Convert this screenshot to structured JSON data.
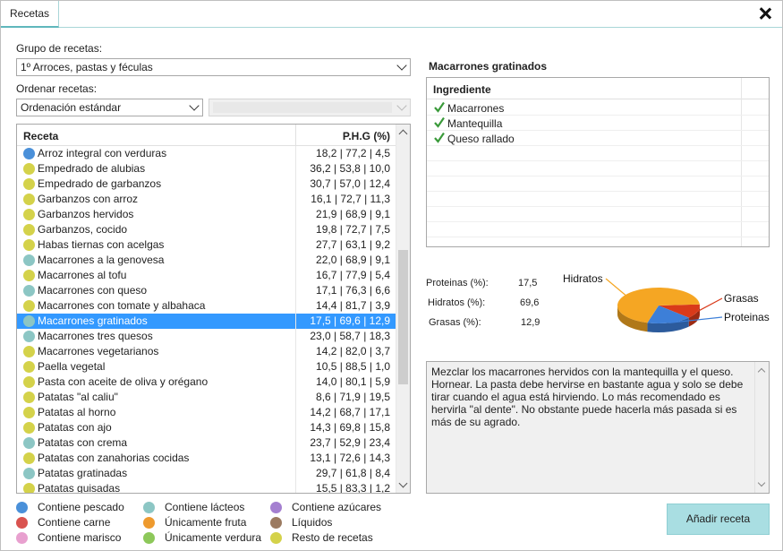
{
  "window": {
    "tab_label": "Recetas"
  },
  "filters": {
    "group_label": "Grupo de recetas:",
    "group_value": "1º Arroces, pastas y féculas",
    "order_label": "Ordenar recetas:",
    "order_value": "Ordenación estándar",
    "secondary_value": ""
  },
  "recipes": {
    "col_name": "Receta",
    "col_phg": "P.H.G (%)",
    "rows": [
      {
        "name": "Arroz integral con verduras",
        "phg": "18,2 | 77,2 | 4,5",
        "color": "#4a90d9"
      },
      {
        "name": "Empedrado de alubias",
        "phg": "36,2 | 53,8 | 10,0",
        "color": "#d4d24a"
      },
      {
        "name": "Empedrado de garbanzos",
        "phg": "30,7 | 57,0 | 12,4",
        "color": "#d4d24a"
      },
      {
        "name": "Garbanzos con arroz",
        "phg": "16,1 | 72,7 | 11,3",
        "color": "#d4d24a"
      },
      {
        "name": "Garbanzos hervidos",
        "phg": "21,9 | 68,9 | 9,1",
        "color": "#d4d24a"
      },
      {
        "name": "Garbanzos, cocido",
        "phg": "19,8 | 72,7 | 7,5",
        "color": "#d4d24a"
      },
      {
        "name": "Habas tiernas con acelgas",
        "phg": "27,7 | 63,1 | 9,2",
        "color": "#d4d24a"
      },
      {
        "name": "Macarrones a la genovesa",
        "phg": "22,0 | 68,9 | 9,1",
        "color": "#8cc6c4"
      },
      {
        "name": "Macarrones al tofu",
        "phg": "16,7 | 77,9 | 5,4",
        "color": "#d4d24a"
      },
      {
        "name": "Macarrones con queso",
        "phg": "17,1 | 76,3 | 6,6",
        "color": "#8cc6c4"
      },
      {
        "name": "Macarrones con tomate y albahaca",
        "phg": "14,4 | 81,7 | 3,9",
        "color": "#d4d24a"
      },
      {
        "name": "Macarrones gratinados",
        "phg": "17,5 | 69,6 | 12,9",
        "color": "#8cc6c4",
        "selected": true
      },
      {
        "name": "Macarrones tres quesos",
        "phg": "23,0 | 58,7 | 18,3",
        "color": "#8cc6c4"
      },
      {
        "name": "Macarrones vegetarianos",
        "phg": "14,2 | 82,0 | 3,7",
        "color": "#d4d24a"
      },
      {
        "name": "Paella vegetal",
        "phg": "10,5 | 88,5 | 1,0",
        "color": "#d4d24a"
      },
      {
        "name": "Pasta con aceite de oliva y orégano",
        "phg": "14,0 | 80,1 | 5,9",
        "color": "#d4d24a"
      },
      {
        "name": "Patatas \"al caliu\"",
        "phg": "8,6 | 71,9 | 19,5",
        "color": "#d4d24a"
      },
      {
        "name": "Patatas al horno",
        "phg": "14,2 | 68,7 | 17,1",
        "color": "#d4d24a"
      },
      {
        "name": "Patatas con ajo",
        "phg": "14,3 | 69,8 | 15,8",
        "color": "#d4d24a"
      },
      {
        "name": "Patatas con crema",
        "phg": "23,7 | 52,9 | 23,4",
        "color": "#8cc6c4"
      },
      {
        "name": "Patatas con zanahorias cocidas",
        "phg": "13,1 | 72,6 | 14,3",
        "color": "#d4d24a"
      },
      {
        "name": "Patatas gratinadas",
        "phg": "29,7 | 61,8 | 8,4",
        "color": "#8cc6c4"
      },
      {
        "name": "Patatas guisadas",
        "phg": "15,5 | 83,3 | 1,2",
        "color": "#d4d24a"
      }
    ]
  },
  "legend": [
    {
      "label": "Contiene pescado",
      "color": "#4a90d9"
    },
    {
      "label": "Contiene carne",
      "color": "#d9534f"
    },
    {
      "label": "Contiene marisco",
      "color": "#e8a0cf"
    },
    {
      "label": "Contiene lácteos",
      "color": "#8cc6c4"
    },
    {
      "label": "Únicamente fruta",
      "color": "#ee9a2e"
    },
    {
      "label": "Únicamente verdura",
      "color": "#8dc85a"
    },
    {
      "label": "Contiene azúcares",
      "color": "#a47fd0"
    },
    {
      "label": "Líquidos",
      "color": "#9b7a60"
    },
    {
      "label": "Resto de recetas",
      "color": "#d4d24a"
    }
  ],
  "detail": {
    "title": "Macarrones gratinados",
    "ing_header": "Ingrediente",
    "ingredients": [
      "Macarrones",
      "Mantequilla",
      "Queso rallado"
    ],
    "stats": [
      {
        "label": "Proteinas (%):",
        "value": "17,5"
      },
      {
        "label": "Hidratos (%):",
        "value": "69,6"
      },
      {
        "label": "Grasas (%):",
        "value": "12,9"
      }
    ],
    "description": "Mezclar los macarrones hervidos con la mantequilla y el queso. Hornear. La pasta debe hervirse en bastante agua y solo se debe tirar cuando el agua está hirviendo. Lo más recomendado es hervirla \"al dente\". No obstante puede hacerla más pasada si es más de su agrado.",
    "add_button": "Añadir receta"
  },
  "chart_data": {
    "type": "pie",
    "labels": [
      "Hidratos",
      "Grasas",
      "Proteinas"
    ],
    "values": [
      69.6,
      12.9,
      17.5
    ],
    "colors": [
      "#f5a623",
      "#d93a1a",
      "#3d7fd8"
    ]
  }
}
